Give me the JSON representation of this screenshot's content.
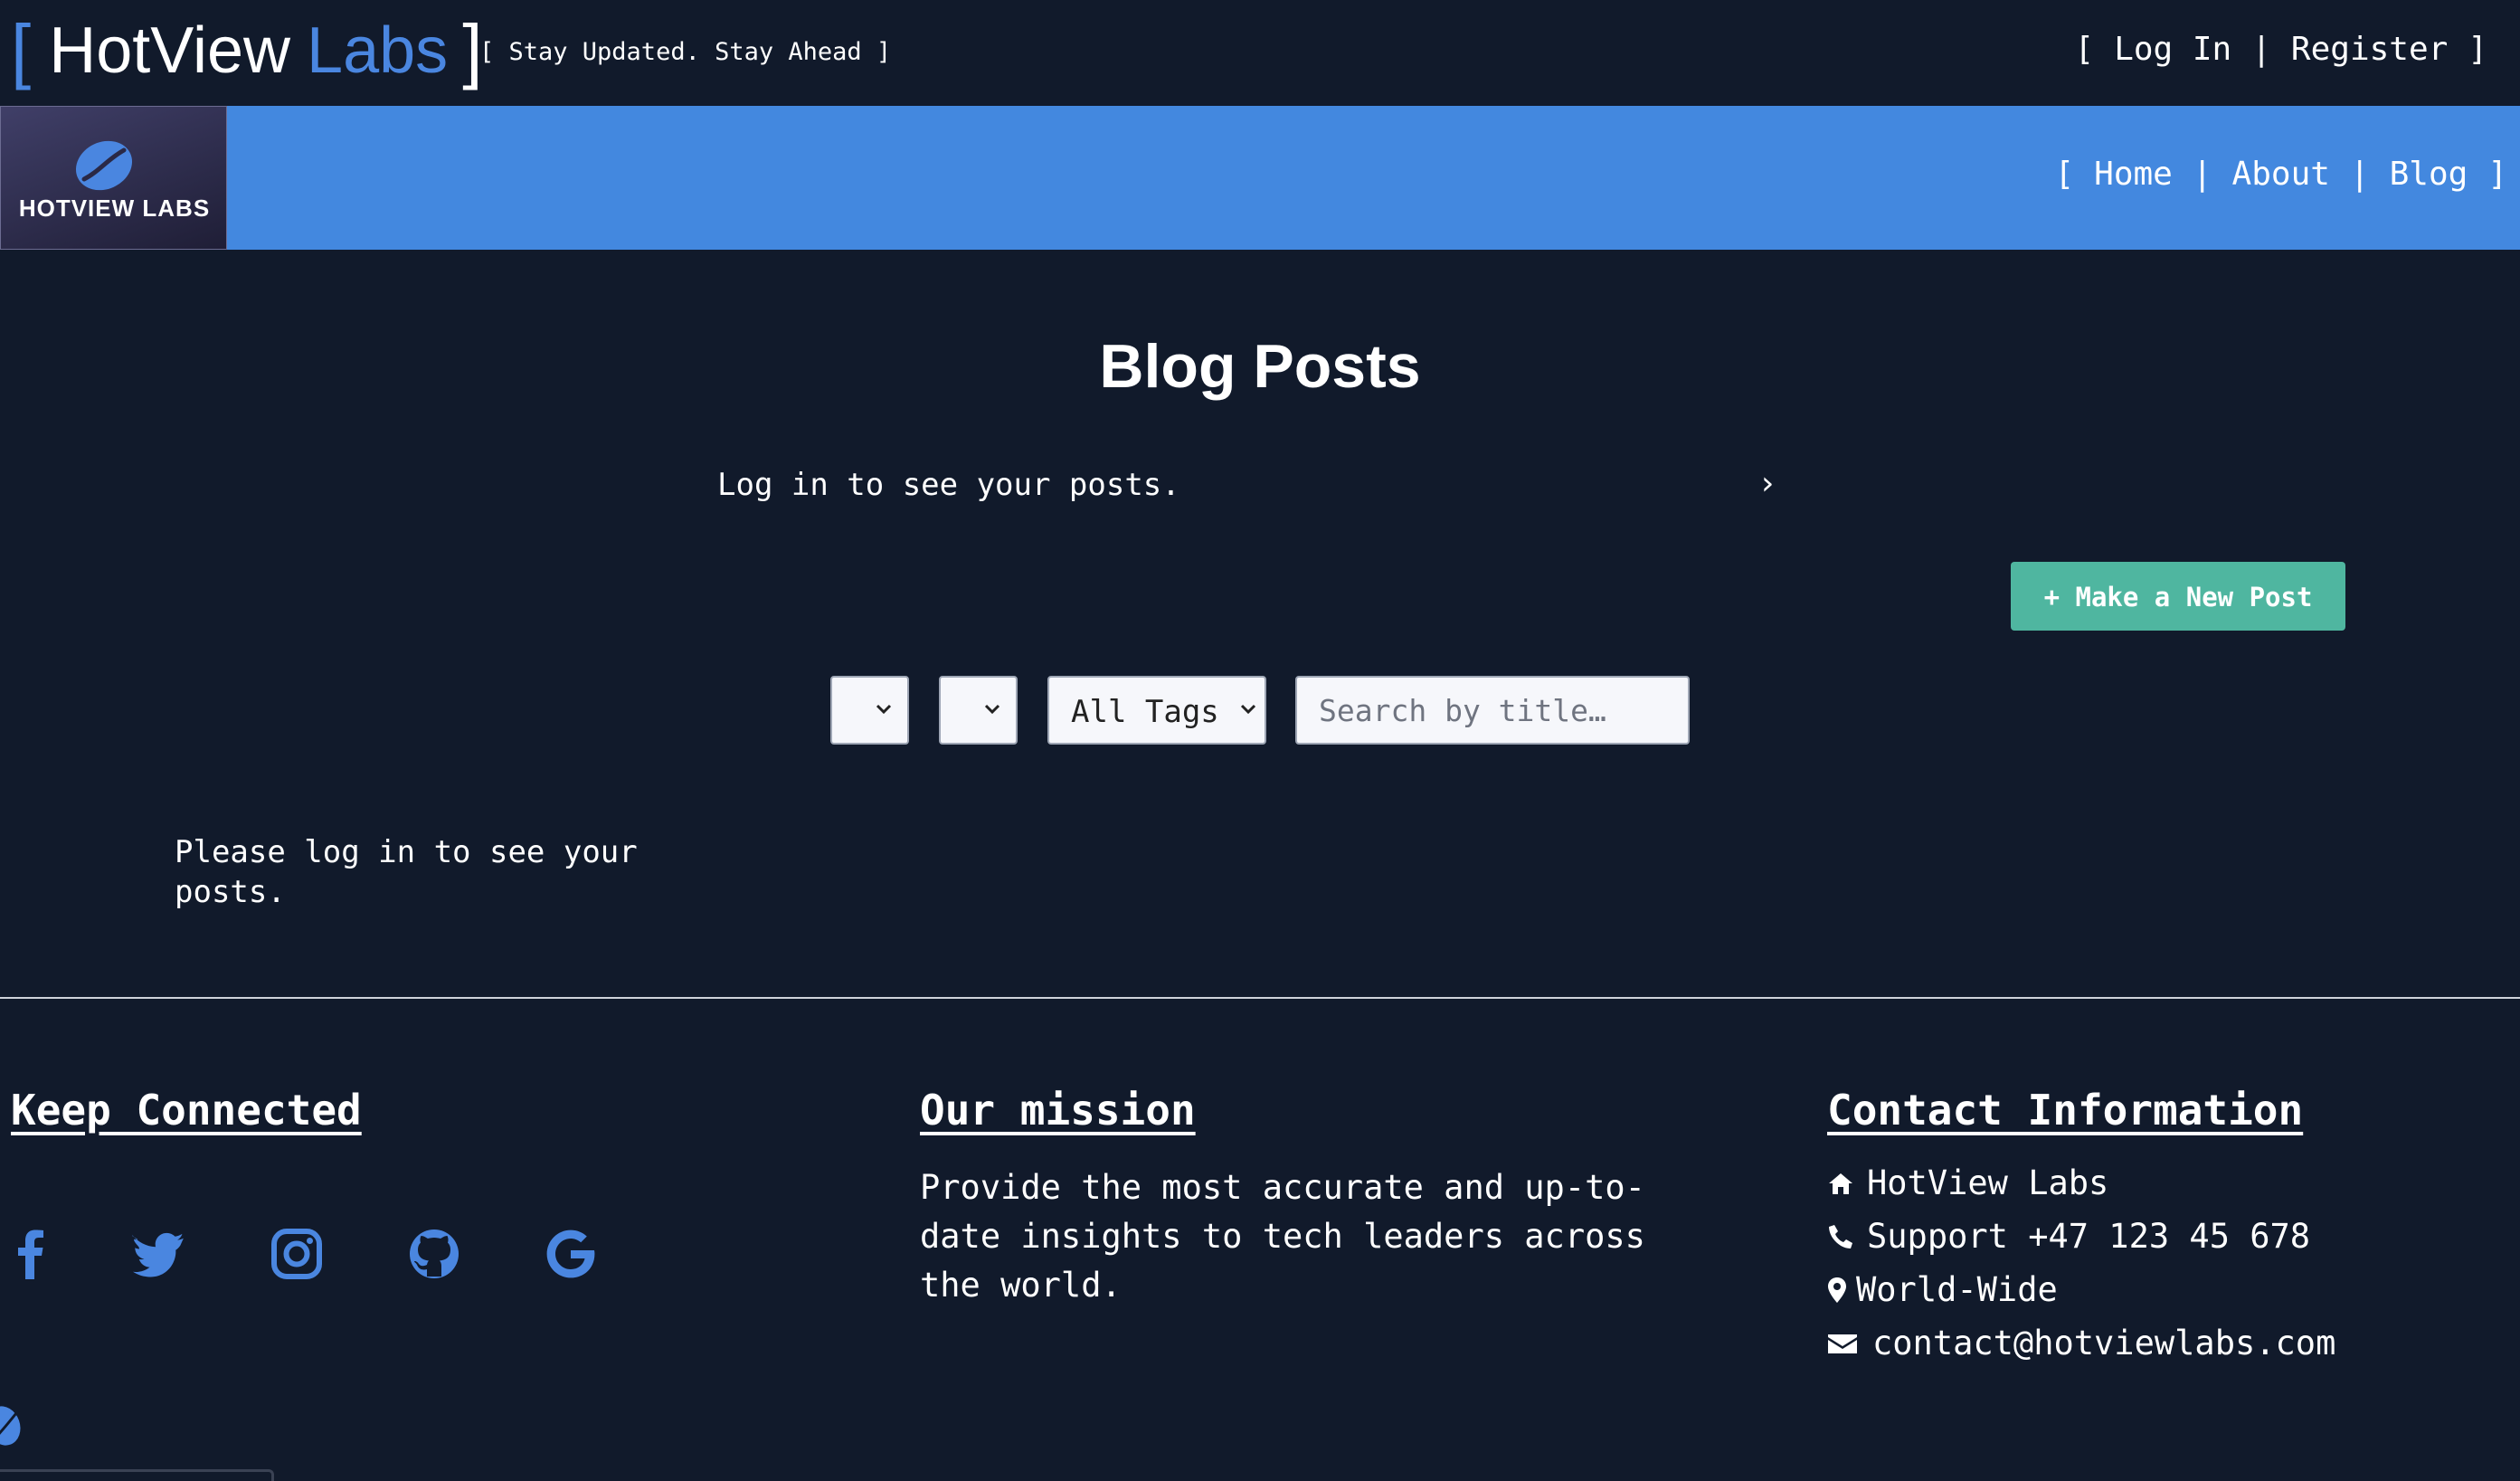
{
  "header": {
    "bracket_open": "[",
    "bracket_close": "]",
    "brand_main": "HotView",
    "brand_accent": "Labs",
    "tagline": "[ Stay Updated. Stay Ahead ]",
    "auth": {
      "open": "[",
      "login": "Log In",
      "sep": "|",
      "register": "Register",
      "close": "]"
    }
  },
  "nav": {
    "logo_text": "HOTVIEW LABS",
    "open": "[",
    "sep": "|",
    "close": "]",
    "items": [
      {
        "label": "Home"
      },
      {
        "label": "About"
      },
      {
        "label": "Blog"
      }
    ]
  },
  "main": {
    "title": "Blog Posts",
    "login_message": "Log in to see your posts.",
    "chevron": "›",
    "new_post_label": "+ Make a New Post",
    "filters": {
      "select1_value": "",
      "select2_value": "",
      "tags_value": "All Tags",
      "search_placeholder": "Search by title…"
    },
    "empty_message": "Please log in to see your posts."
  },
  "footer": {
    "keep_connected": {
      "heading": "Keep Connected",
      "icons": [
        "facebook-icon",
        "twitter-icon",
        "instagram-icon",
        "github-icon",
        "google-icon"
      ]
    },
    "mission": {
      "heading": "Our mission",
      "text": "Provide the most accurate and up-to-date insights to tech leaders across the world."
    },
    "contact": {
      "heading": "Contact Information",
      "company": "HotView Labs",
      "phone": "Support +47 123 45 678",
      "location": "World-Wide",
      "email": "contact@hotviewlabs.com"
    }
  },
  "colors": {
    "background": "#111a2b",
    "accent": "#4388df",
    "button": "#4fb6a0"
  }
}
